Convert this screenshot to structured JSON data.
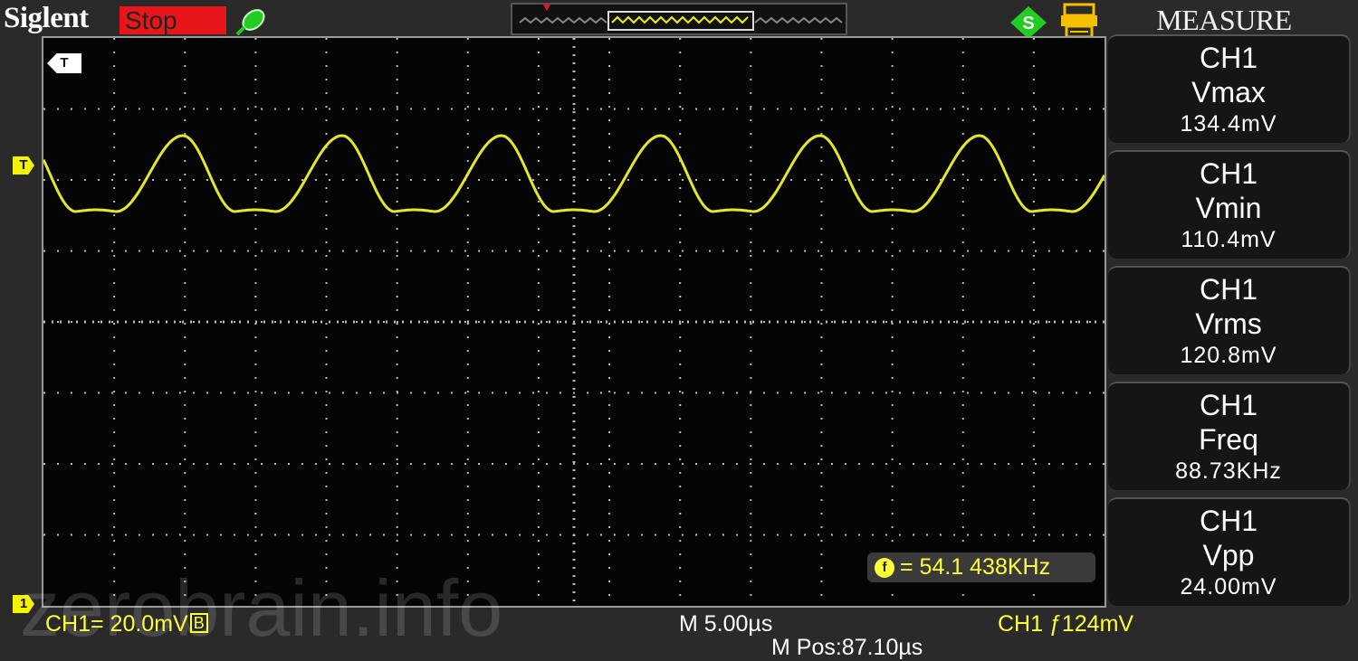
{
  "header": {
    "brand": "Siglent",
    "run_status": "Stop",
    "colors": {
      "run_status_bg": "#e8161a",
      "accent": "#f4f400",
      "probe_icon": "#22cc22"
    }
  },
  "screen": {
    "trigger_marker": "T",
    "channel_marker": "1",
    "frequency_counter": "= 54.1 438KHz",
    "counter_icon": "f",
    "watermark": "zerobrain.info"
  },
  "status_bar": {
    "channel_scale": "CH1= 20.0mV",
    "bandwidth_flag": "B",
    "timebase": "M 5.00µs",
    "horizontal_position": "M Pos:87.10µs",
    "trigger": "CH1 ƒ124mV"
  },
  "measure": {
    "title": "MEASURE",
    "items": [
      {
        "source": "CH1",
        "parameter": "Vmax",
        "value": "134.4mV"
      },
      {
        "source": "CH1",
        "parameter": "Vmin",
        "value": "110.4mV"
      },
      {
        "source": "CH1",
        "parameter": "Vrms",
        "value": "120.8mV"
      },
      {
        "source": "CH1",
        "parameter": "Freq",
        "value": "88.73KHz"
      },
      {
        "source": "CH1",
        "parameter": "Vpp",
        "value": "24.00mV"
      }
    ]
  },
  "icons": {
    "probe": "probe-icon",
    "usb": "usb-icon",
    "print": "print-icon",
    "counter": "frequency-counter-icon"
  }
}
